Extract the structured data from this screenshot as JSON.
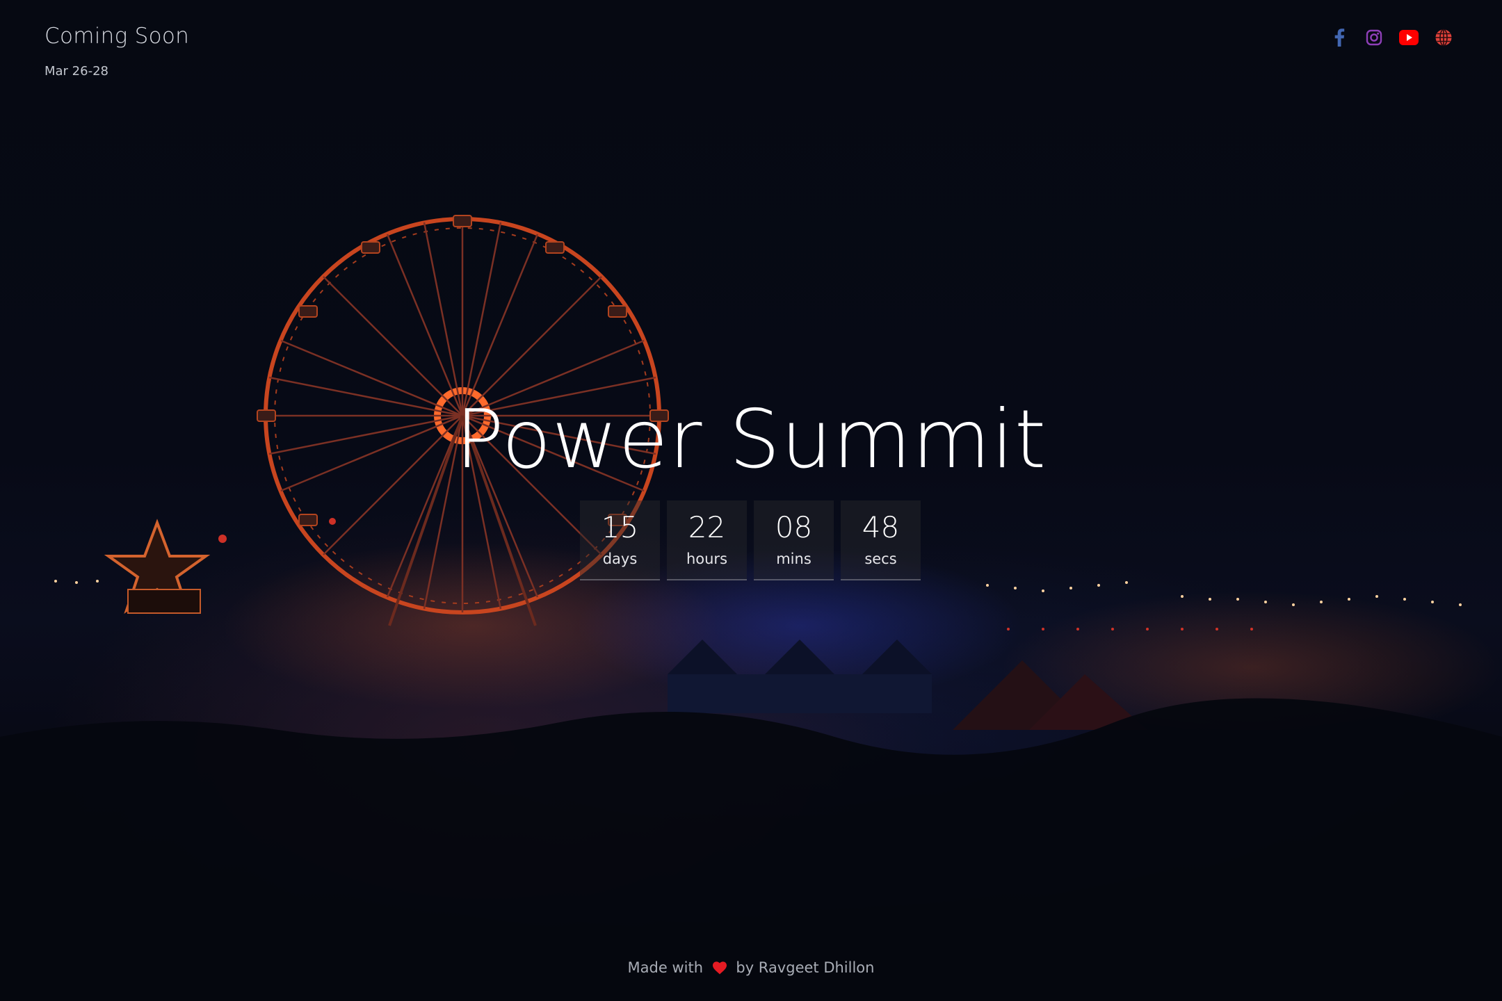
{
  "header": {
    "title": "Coming Soon",
    "date": "Mar 26-28"
  },
  "social": [
    {
      "icon": "facebook-icon",
      "color": "#4267b2"
    },
    {
      "icon": "instagram-icon",
      "color": "#8e3fb8"
    },
    {
      "icon": "youtube-icon",
      "color": "#ff0000"
    },
    {
      "icon": "globe-icon",
      "color": "#e0413a"
    }
  ],
  "hero": {
    "title": "Power Summit"
  },
  "countdown": [
    {
      "value": "15",
      "label": "days"
    },
    {
      "value": "22",
      "label": "hours"
    },
    {
      "value": "08",
      "label": "mins"
    },
    {
      "value": "48",
      "label": "secs"
    }
  ],
  "footer": {
    "prefix": "Made with",
    "suffix": "by Ravgeet Dhillon",
    "heart_color": "#e51b23"
  }
}
